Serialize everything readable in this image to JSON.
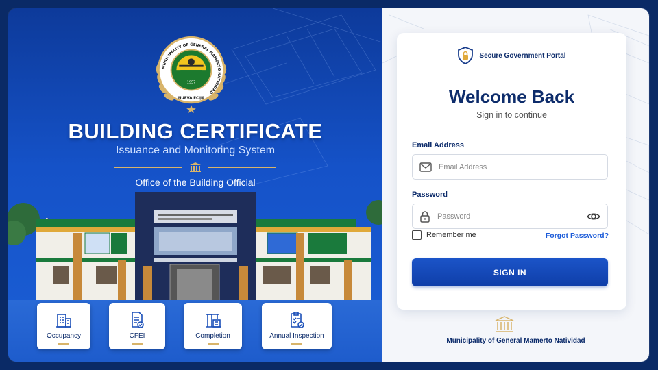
{
  "hero": {
    "seal": {
      "ring_text": "MUNICIPALITY OF GENERAL MAMERTO NATIVIDAD",
      "year": "1957",
      "province": "NUEVA ECIJA"
    },
    "title": "BUILDING CERTIFICATE",
    "subtitle": "Issuance and Monitoring System",
    "office": "Office of the Building Official",
    "cards": [
      {
        "label": "Occupancy",
        "icon": "building-icon"
      },
      {
        "label": "CFEI",
        "icon": "document-check-icon"
      },
      {
        "label": "Completion",
        "icon": "construction-icon"
      },
      {
        "label": "Annual Inspection",
        "icon": "clipboard-check-icon"
      }
    ]
  },
  "login": {
    "portal_label": "Secure Government Portal",
    "welcome": "Welcome Back",
    "subtitle": "Sign in to continue",
    "email_label": "Email Address",
    "email_placeholder": "Email Address",
    "email_value": "",
    "password_label": "Password",
    "password_placeholder": "Password",
    "password_value": "",
    "remember_label": "Remember me",
    "remember_checked": false,
    "forgot_label": "Forgot Password?",
    "signin_label": "SIGN IN"
  },
  "footer": {
    "municipality": "Municipality of General Mamerto Natividad"
  },
  "colors": {
    "primary": "#0d2c6b",
    "accent_blue": "#1a5ad8",
    "gold": "#d8b46a",
    "hero_bg": "#1552c8"
  }
}
